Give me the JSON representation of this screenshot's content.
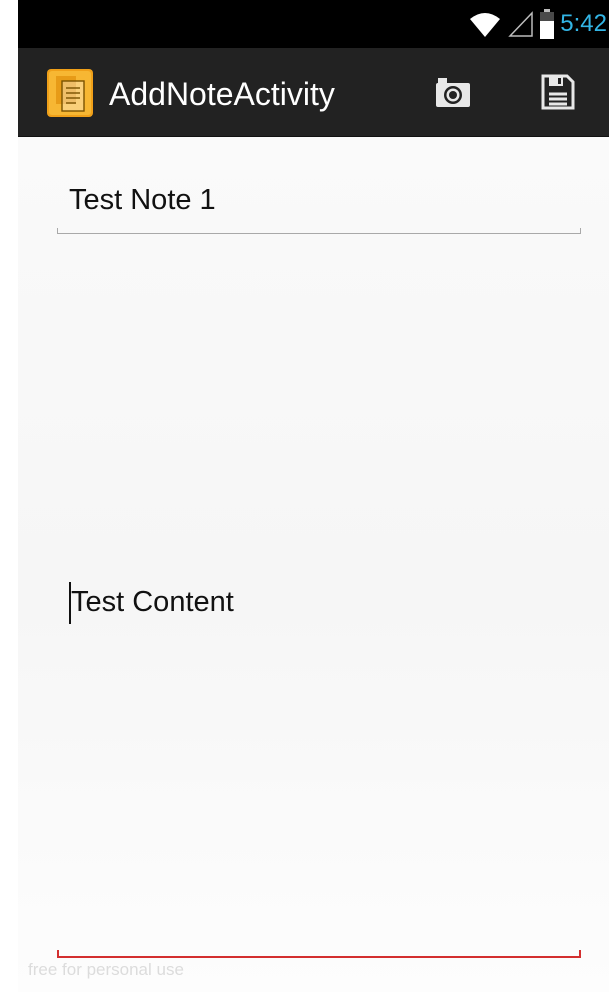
{
  "status_bar": {
    "time": "5:42",
    "icons": [
      "wifi-icon",
      "signal-icon",
      "battery-icon"
    ],
    "time_color": "#33b5e5"
  },
  "action_bar": {
    "title": "AddNoteActivity",
    "app_icon": "notes-app-icon",
    "actions": [
      "camera-icon",
      "save-icon"
    ],
    "background": "#222222"
  },
  "note": {
    "title_value": "Test Note 1",
    "content_value": "Test Content"
  },
  "watermark": "free for personal use",
  "colors": {
    "content_underline": "#d32f2f",
    "title_underline": "#a9a9a9"
  }
}
